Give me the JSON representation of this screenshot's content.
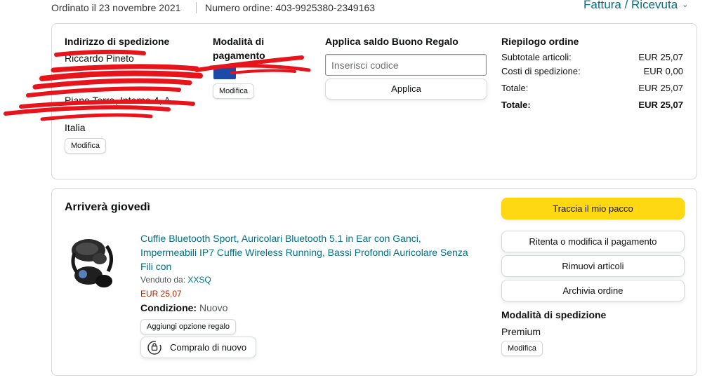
{
  "header": {
    "order_date": "Ordinato il 23 novembre 2021",
    "order_number": "Numero ordine: 403-9925380-2349163",
    "invoice_link": "Fattura / Ricevuta"
  },
  "shipping_address": {
    "title": "Indirizzo di spedizione",
    "lines": [
      "Riccardo Pineto",
      "Piano Terra, Interno 4, A",
      "Italia"
    ],
    "edit_label": "Modifica"
  },
  "payment": {
    "title": "Modalità di pagamento",
    "edit_label": "Modifica"
  },
  "gift_card": {
    "title": "Applica saldo Buono Regalo",
    "placeholder": "Inserisci codice",
    "apply_label": "Applica"
  },
  "summary": {
    "title": "Riepilogo ordine",
    "rows": [
      {
        "label": "Subtotale articoli:",
        "value": "EUR 25,07"
      },
      {
        "label": "Costi di spedizione:",
        "value": "EUR 0,00"
      },
      {
        "label": "Totale:",
        "value": "EUR 25,07"
      },
      {
        "label": "Totale:",
        "value": "EUR 25,07"
      }
    ]
  },
  "delivery": {
    "title": "Arriverà giovedì",
    "product": {
      "title": "Cuffie Bluetooth Sport, Auricolari Bluetooth 5.1 in Ear con Ganci, Impermeabili IP7 Cuffie Wireless Running, Bassi Profondi Auricolare Senza Fili con",
      "sold_by_label": "Venduto da:",
      "seller": "XXSQ",
      "price": "EUR 25,07",
      "condition_label": "Condizione:",
      "condition_value": "Nuovo",
      "gift_option_label": "Aggiungi opzione regalo",
      "buy_again_label": "Compralo di nuovo"
    },
    "actions": {
      "track": "Traccia il mio pacco",
      "retry_payment": "Ritenta o modifica il pagamento",
      "remove_items": "Rimuovi articoli",
      "archive_order": "Archivia ordine"
    },
    "shipping_method": {
      "title": "Modalità di spedizione",
      "value": "Premium",
      "edit_label": "Modifica"
    }
  },
  "colors": {
    "link": "#007185",
    "price": "#b12704",
    "track_button": "#ffd814",
    "redaction": "#e8141b"
  }
}
